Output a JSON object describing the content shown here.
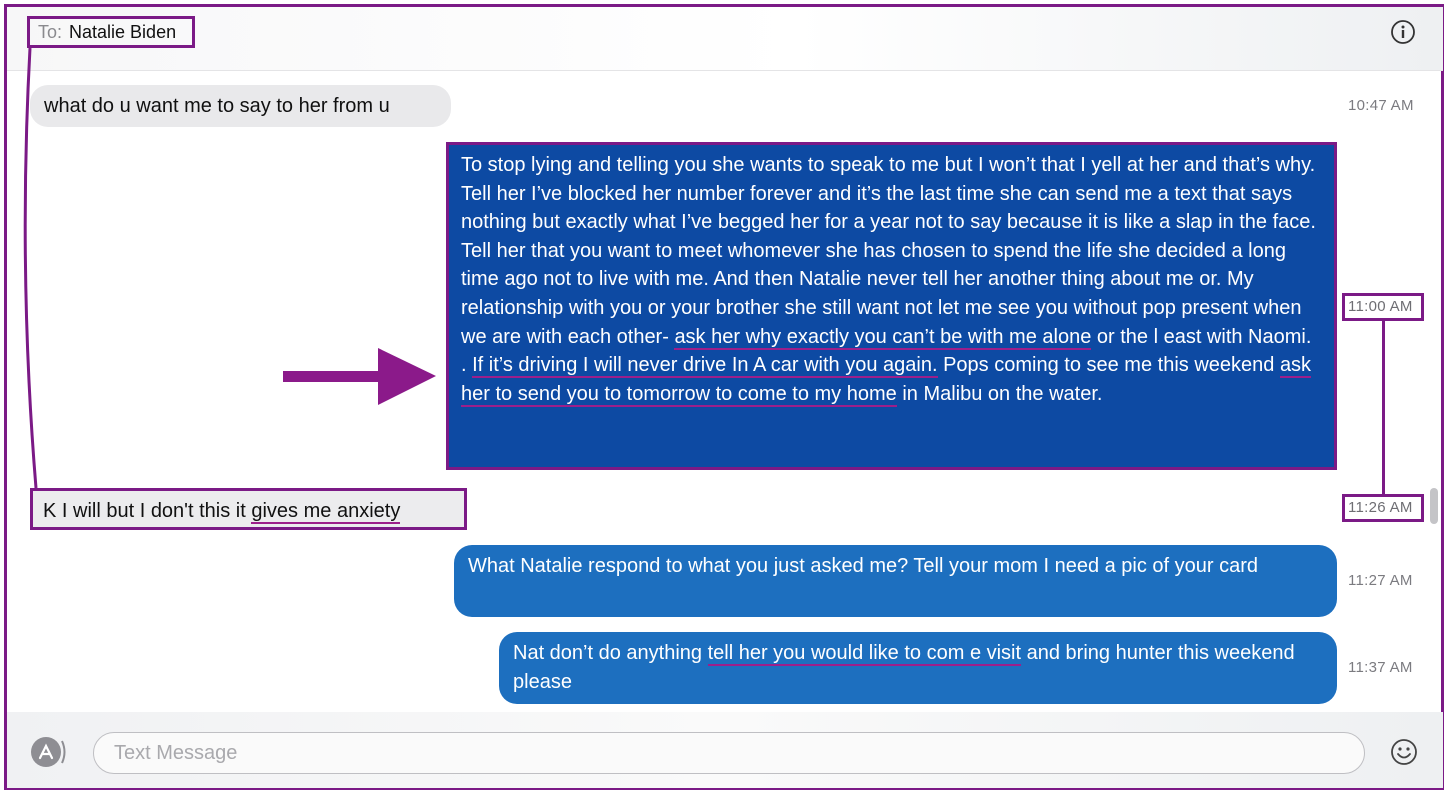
{
  "header": {
    "to_label": "To:",
    "recipient": "Natalie Biden"
  },
  "icons": {
    "info": "info-icon",
    "appstore": "appstore-icon",
    "emoji": "emoji-icon",
    "arrow": "arrow-annotation-icon"
  },
  "colors": {
    "outgoing_bubble": "#1d6fbf",
    "highlighted_bubble": "#0d4aa3",
    "incoming_bubble": "#e9e9eb",
    "annotation": "#7b1a86"
  },
  "messages": [
    {
      "direction": "incoming",
      "time": "10:47 AM",
      "text": "what do u want me to say to her from u"
    },
    {
      "direction": "outgoing",
      "time": "11:00 AM",
      "highlighted": true,
      "parts": [
        "To stop lying and telling you she wants to speak to me but I won’t that I yell at her and that’s why. Tell her I’ve blocked her number forever and it’s the last time she can send me a text that says nothing but exactly what I’ve begged her for a year not to say because it is like a slap in the face. Tell her that you want to meet whomever she has chosen to spend the life she decided a long time ago not to live with me. And then Natalie never tell her another thing about me or. My relationship with you or your brother she still want not let me see you without pop present when we are with each other- ",
        "ask her why exactly you can’t be with me alone",
        " or the l east with Naomi. . ",
        "If it’s driving I will never drive In A car with you again.",
        "  Pops coming to see me this weekend ",
        "ask her to send you to tomorrow to come to my home",
        " in Malibu on the water."
      ]
    },
    {
      "direction": "incoming",
      "time": "11:26 AM",
      "highlighted": true,
      "parts": [
        "K I will but I don't this it ",
        "gives me anxiety"
      ]
    },
    {
      "direction": "outgoing",
      "time": "11:27 AM",
      "text": "What Natalie respond to what you just asked me? Tell your mom I need a pic of your card"
    },
    {
      "direction": "outgoing",
      "time": "11:37 AM",
      "parts": [
        "Nat don’t do anything ",
        "tell her you would like to com e visit",
        " and bring hunter this weekend please"
      ]
    }
  ],
  "composer": {
    "placeholder": "Text Message"
  }
}
